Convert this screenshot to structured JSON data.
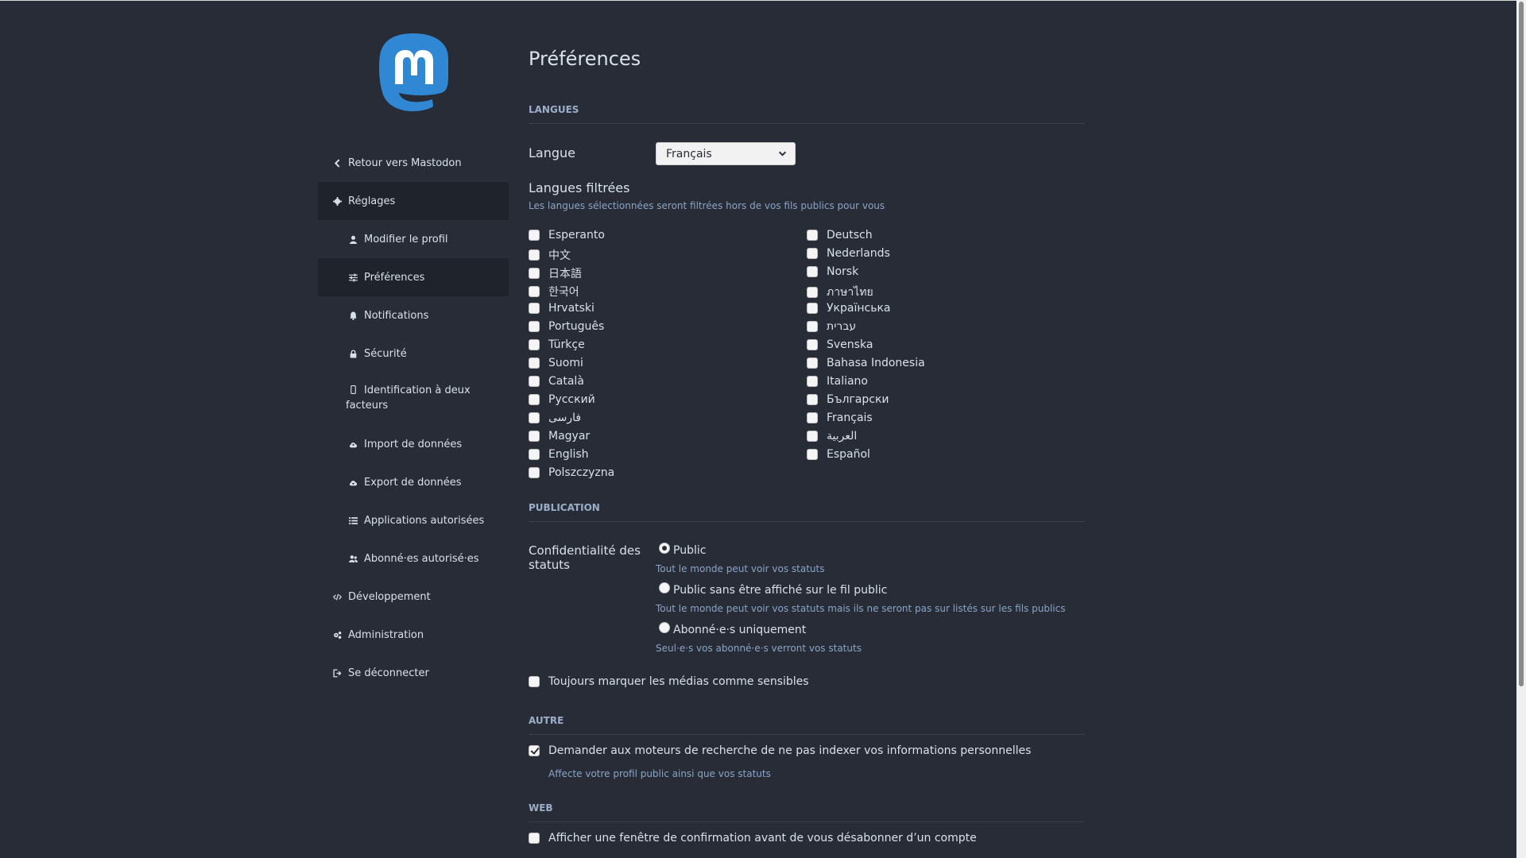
{
  "sidebar": {
    "back": "Retour vers Mastodon",
    "settings": "Réglages",
    "edit_profile": "Modifier le profil",
    "preferences": "Préférences",
    "notifications": "Notifications",
    "security": "Sécurité",
    "two_factor": "Identification à deux facteurs",
    "import": "Import de données",
    "export": "Export de données",
    "apps": "Applications autorisées",
    "followers": "Abonné·es autorisé·es",
    "development": "Développement",
    "administration": "Administration",
    "logout": "Se déconnecter"
  },
  "page": {
    "title": "Préférences"
  },
  "languages": {
    "section": "LANGUES",
    "label": "Langue",
    "selected": "Français",
    "filtered_label": "Langues filtrées",
    "filtered_hint": "Les langues sélectionnées seront filtrées hors de vos fils publics pour vous",
    "col1": [
      "Esperanto",
      "中文",
      "日本語",
      "한국어",
      "Hrvatski",
      "Português",
      "Türkçe",
      "Suomi",
      "Català",
      "Русский",
      "فارسی",
      "Magyar",
      "English",
      "Polszczyzna"
    ],
    "col2": [
      "Deutsch",
      "Nederlands",
      "Norsk",
      "ภาษาไทย",
      "Українська",
      "עברית",
      "Svenska",
      "Bahasa Indonesia",
      "Italiano",
      "Български",
      "Français",
      "العربية",
      "Español"
    ]
  },
  "publication": {
    "section": "PUBLICATION",
    "privacy_label": "Confidentialité des statuts",
    "options": [
      {
        "label": "Public",
        "hint": "Tout le monde peut voir vos statuts",
        "selected": true
      },
      {
        "label": "Public sans être affiché sur le fil public",
        "hint": "Tout le monde peut voir vos statuts mais ils ne seront pas sur listés sur les fils publics",
        "selected": false
      },
      {
        "label": "Abonné·e·s uniquement",
        "hint": "Seul·e·s vos abonné·e·s verront vos statuts",
        "selected": false
      }
    ],
    "sensitive": "Toujours marquer les médias comme sensibles"
  },
  "other": {
    "section": "AUTRE",
    "noindex": "Demander aux moteurs de recherche de ne pas indexer vos informations personnelles",
    "noindex_hint": "Affecte votre profil public ainsi que vos statuts"
  },
  "web": {
    "section": "WEB",
    "unfollow_modal": "Afficher une fenêtre de confirmation avant de vous désabonner d’un compte"
  },
  "colors": {
    "background": "#282c37",
    "accent": "#2b90d9",
    "hint": "#8aa4c4"
  }
}
